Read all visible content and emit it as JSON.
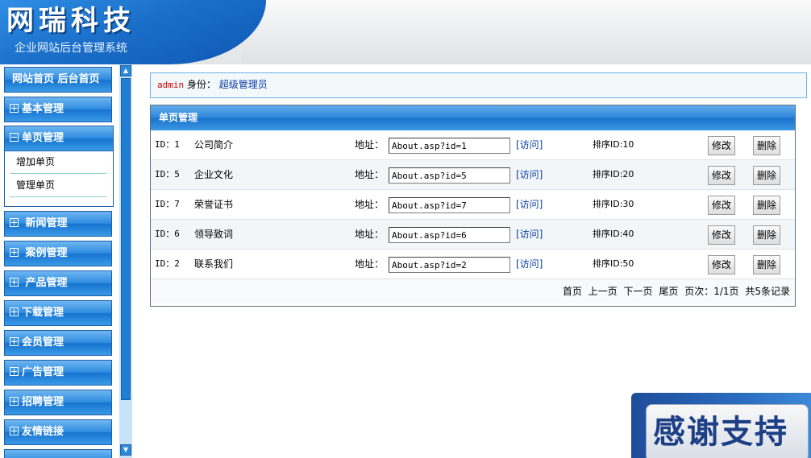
{
  "header": {
    "logo_title": "网瑞科技",
    "logo_subtitle": "企业网站后台管理系统"
  },
  "sidebar": {
    "top_links": "网站首页 后台首页",
    "sections": [
      {
        "label": "基本管理"
      },
      {
        "label": "单页管理",
        "expanded": true,
        "items": [
          "增加单页",
          "管理单页"
        ]
      },
      {
        "label": "新闻管理"
      },
      {
        "label": "案例管理"
      },
      {
        "label": "产品管理"
      },
      {
        "label": "下载管理"
      },
      {
        "label": "会员管理"
      },
      {
        "label": "广告管理"
      },
      {
        "label": "招聘管理"
      },
      {
        "label": "友情链接"
      }
    ]
  },
  "userbar": {
    "username": "admin",
    "role_label": "身份：",
    "role": "超级管理员"
  },
  "panel": {
    "title": "单页管理",
    "addr_label": "地址：",
    "visit_label": "[访问]",
    "edit_label": "修改",
    "delete_label": "删除",
    "rows": [
      {
        "id": "ID：1",
        "name": "公司简介",
        "address": "About.asp?id=1",
        "sort": "排序ID:10"
      },
      {
        "id": "ID：5",
        "name": "企业文化",
        "address": "About.asp?id=5",
        "sort": "排序ID:20"
      },
      {
        "id": "ID：7",
        "name": "荣誉证书",
        "address": "About.asp?id=7",
        "sort": "排序ID:30"
      },
      {
        "id": "ID：6",
        "name": "领导致词",
        "address": "About.asp?id=6",
        "sort": "排序ID:40"
      },
      {
        "id": "ID：2",
        "name": "联系我们",
        "address": "About.asp?id=2",
        "sort": "排序ID:50"
      }
    ],
    "pager": {
      "first": "首页",
      "prev": "上一页",
      "next": "下一页",
      "last": "尾页",
      "page_info": "页次：1/1页",
      "total": "共5条记录"
    }
  },
  "badge": {
    "text": "感谢支持"
  },
  "colors": {
    "menu_blue": "#2f8ce0",
    "panel_head_blue": "#2b86da",
    "role_text": "#0a3da8",
    "username_red": "#cc0000"
  }
}
